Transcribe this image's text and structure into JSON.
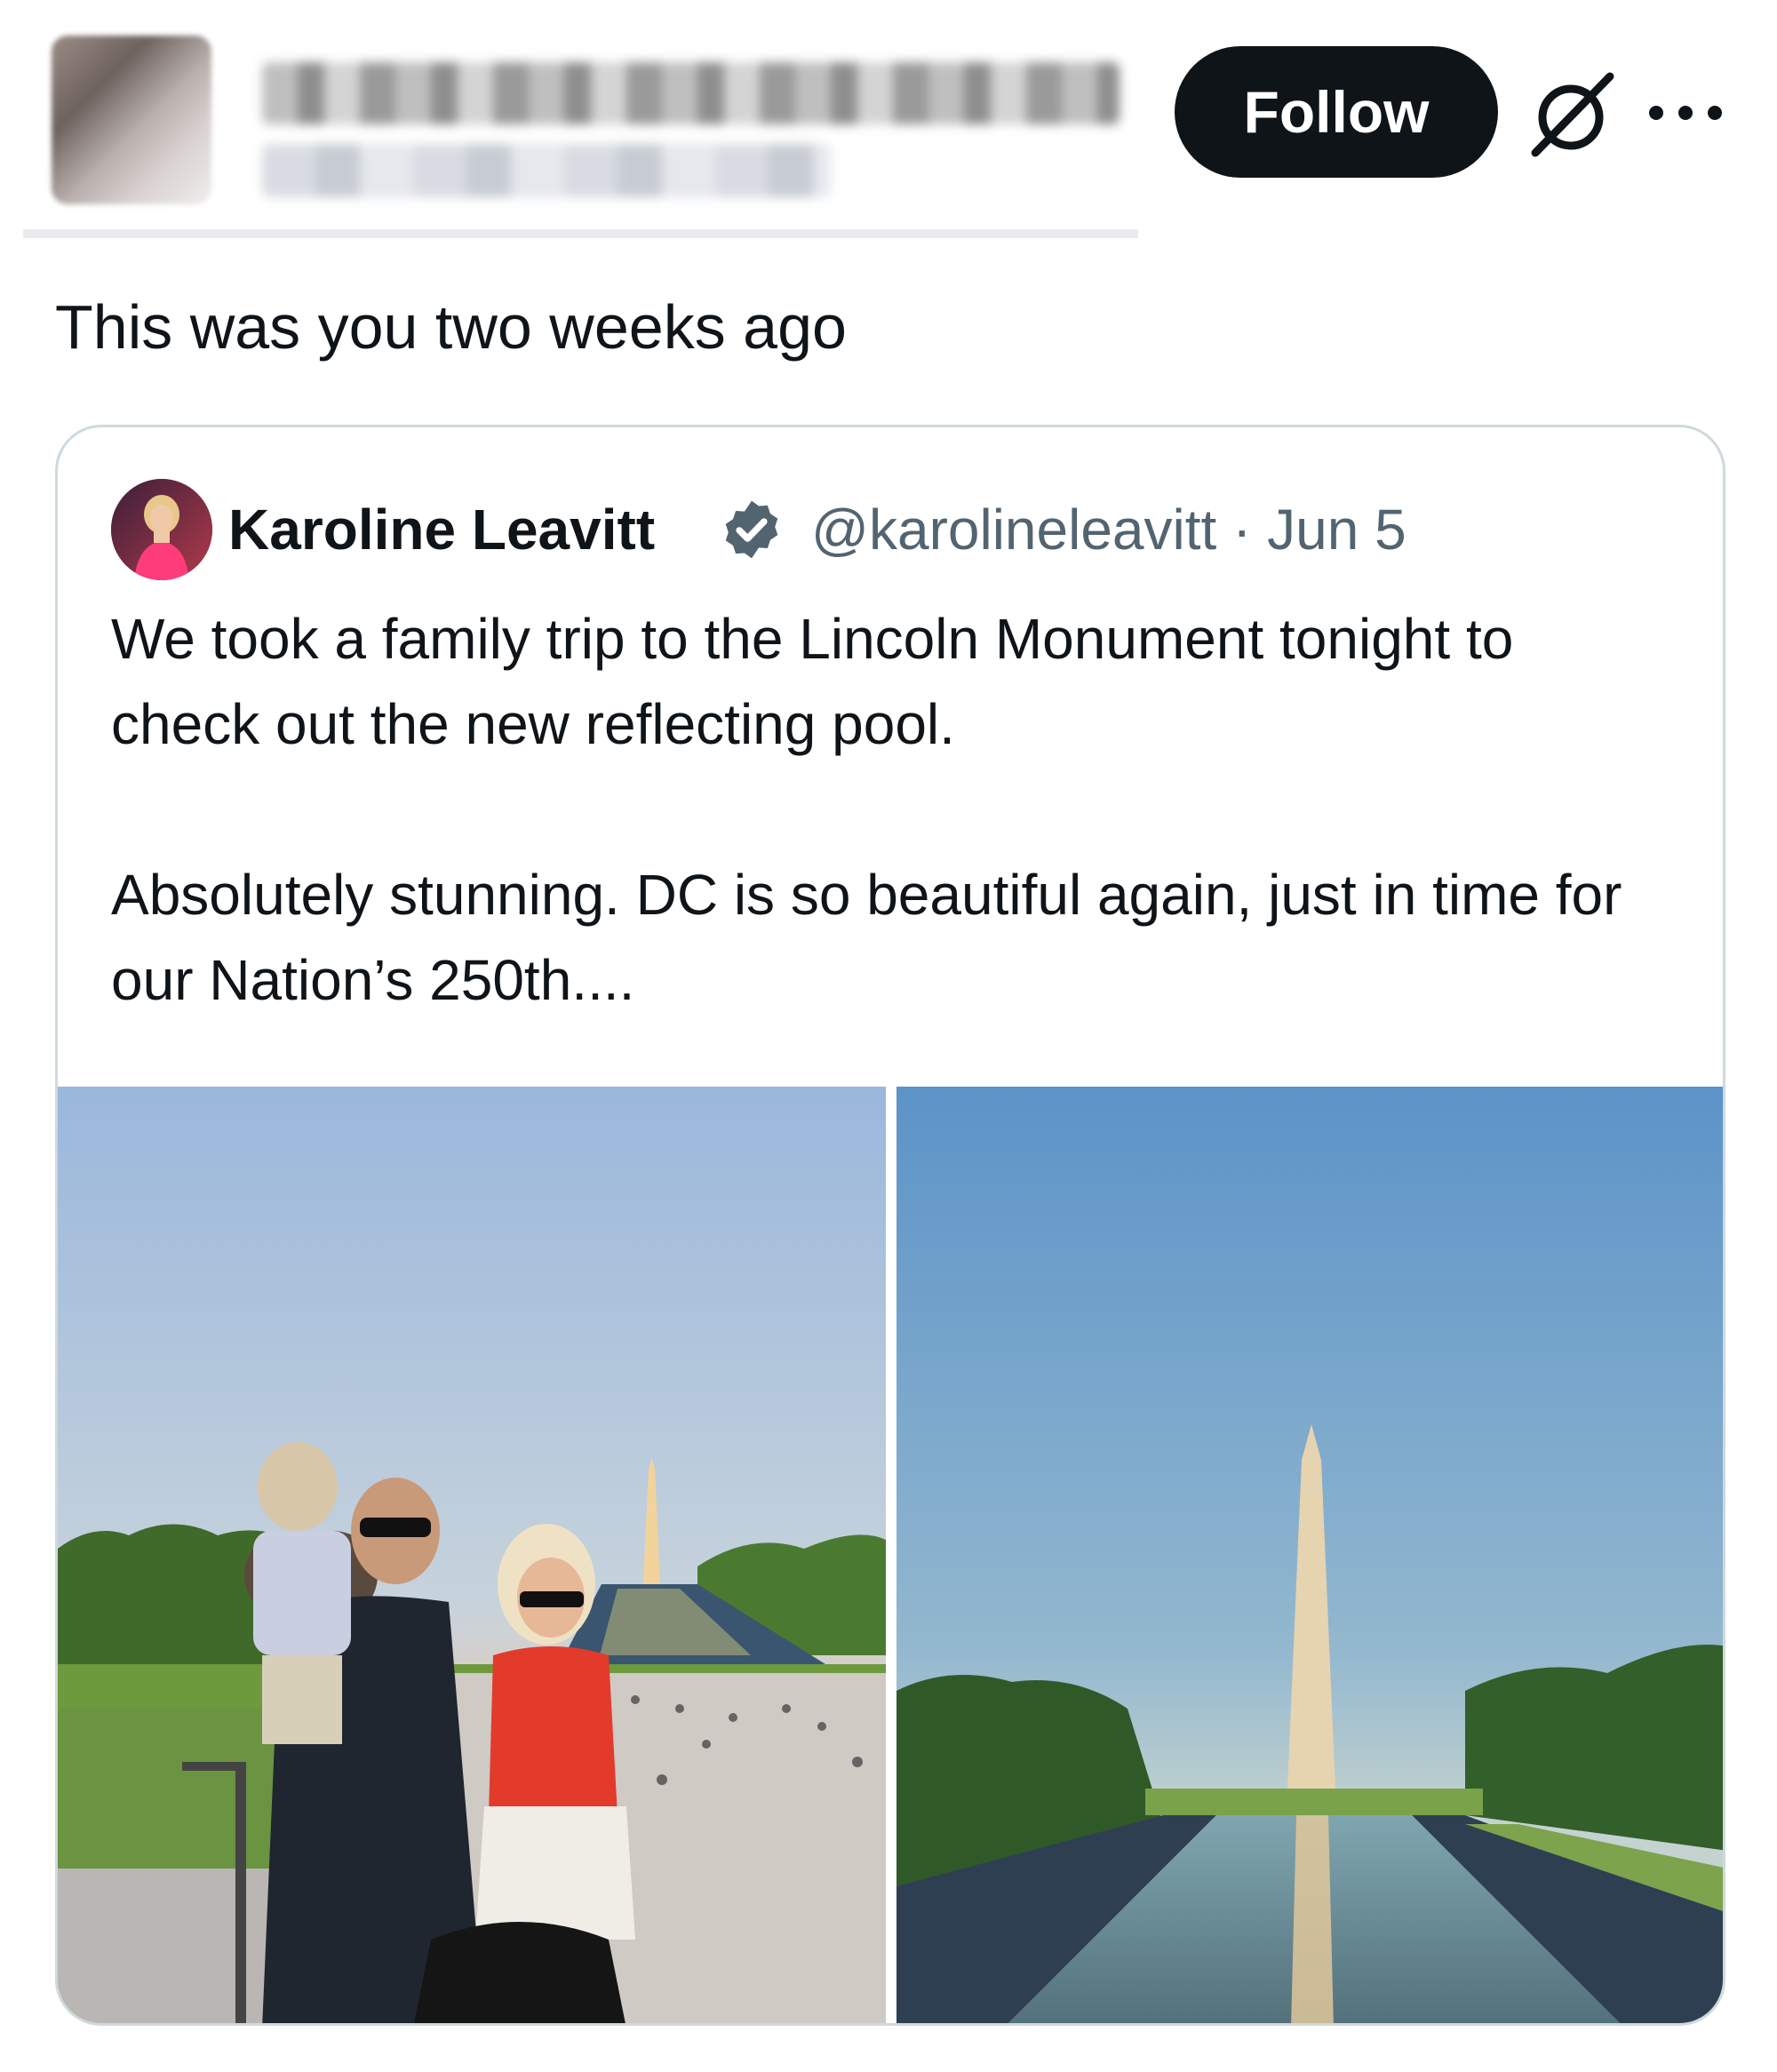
{
  "header": {
    "follow_label": "Follow",
    "icons": [
      "grok-icon",
      "more-icon"
    ]
  },
  "post": {
    "text": "This was you two weeks ago"
  },
  "quote": {
    "name": "Karoline Leavitt",
    "handle_date": "@karolineleavitt · Jun 5",
    "verified_color": "#536471",
    "paragraph1": "We took a family trip to the Lincoln Monument tonight to check out the new reflecting pool.",
    "paragraph2": "Absolutely stunning. DC is so beautiful again, just in time for our Nation’s 250th...."
  },
  "colors": {
    "button_bg": "#0f1419",
    "text_secondary": "#536471",
    "card_border": "#cfd9de"
  }
}
